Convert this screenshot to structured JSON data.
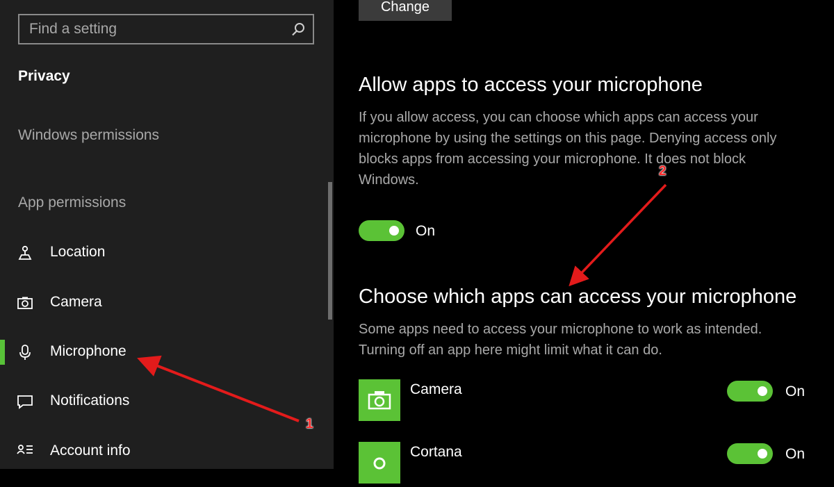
{
  "sidebar": {
    "search": {
      "placeholder": "Find a setting",
      "icon": "search-icon"
    },
    "section_title": "Privacy",
    "groups": {
      "windows_permissions": "Windows permissions",
      "app_permissions": "App permissions"
    },
    "items": [
      {
        "label": "Location",
        "icon": "location-icon",
        "active": false
      },
      {
        "label": "Camera",
        "icon": "camera-icon",
        "active": false
      },
      {
        "label": "Microphone",
        "icon": "microphone-icon",
        "active": true
      },
      {
        "label": "Notifications",
        "icon": "notifications-icon",
        "active": false
      },
      {
        "label": "Account info",
        "icon": "account-info-icon",
        "active": false
      }
    ],
    "accent_color": "#58c238"
  },
  "main": {
    "change_button": "Change",
    "allow_section": {
      "heading": "Allow apps to access your microphone",
      "description": "If you allow access, you can choose which apps can access your microphone by using the settings on this page. Denying access only blocks apps from accessing your microphone. It does not block Windows.",
      "toggle_state": "On"
    },
    "choose_section": {
      "heading": "Choose which apps can access your microphone",
      "description": "Some apps need to access your microphone to work as intended. Turning off an app here might limit what it can do.",
      "apps": [
        {
          "name": "Camera",
          "icon": "camera-app-icon",
          "toggle_state": "On"
        },
        {
          "name": "Cortana",
          "icon": "cortana-app-icon",
          "toggle_state": "On"
        }
      ]
    },
    "toggle_color": "#5bc236"
  },
  "annotations": {
    "marker_1": "1",
    "marker_2": "2",
    "color": "#e31b1b"
  }
}
